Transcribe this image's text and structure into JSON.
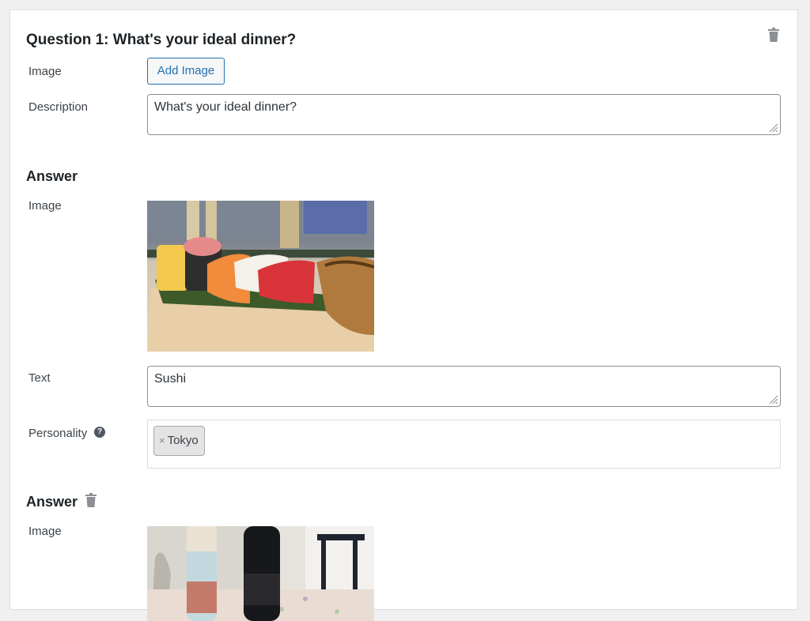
{
  "question": {
    "title": "Question 1: What's your ideal dinner?",
    "image_label": "Image",
    "add_image_label": "Add Image",
    "description_label": "Description",
    "description_value": "What's your ideal dinner?"
  },
  "answers": [
    {
      "heading": "Answer",
      "image_label": "Image",
      "text_label": "Text",
      "text_value": "Sushi",
      "personality_label": "Personality",
      "personality_help": "?",
      "tags": [
        {
          "remove": "×",
          "label": "Tokyo"
        }
      ]
    },
    {
      "heading": "Answer",
      "image_label": "Image"
    }
  ],
  "icons": {
    "delete": "trash-icon",
    "help": "question-circle-icon",
    "resize": "resize-grip-icon"
  },
  "colors": {
    "accent": "#2271b1",
    "text": "#1d2327",
    "muted_icon": "#8c8f94"
  }
}
